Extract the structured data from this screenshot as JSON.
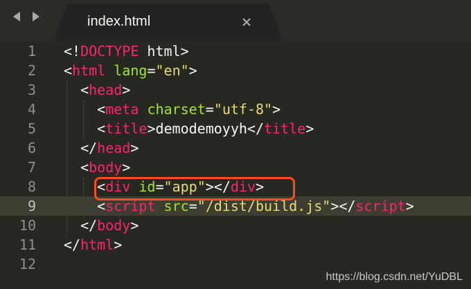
{
  "tab": {
    "title": "index.html",
    "close_icon": "close-icon"
  },
  "nav": {
    "back_icon": "chevron-left-icon",
    "forward_icon": "chevron-right-icon"
  },
  "lines": [
    {
      "num": "1",
      "tokens": [
        [
          "p",
          "<!"
        ],
        [
          "t",
          "DOCTYPE"
        ],
        [
          "p",
          " html>"
        ]
      ]
    },
    {
      "num": "2",
      "tokens": [
        [
          "p",
          "<"
        ],
        [
          "t",
          "html"
        ],
        [
          "p",
          " "
        ],
        [
          "a",
          "lang"
        ],
        [
          "p",
          "="
        ],
        [
          "s",
          "\"en\""
        ],
        [
          "p",
          ">"
        ]
      ]
    },
    {
      "num": "3",
      "tokens": [
        [
          "p",
          "  <"
        ],
        [
          "t",
          "head"
        ],
        [
          "p",
          ">"
        ]
      ]
    },
    {
      "num": "4",
      "tokens": [
        [
          "p",
          "    <"
        ],
        [
          "t",
          "meta"
        ],
        [
          "p",
          " "
        ],
        [
          "a",
          "charset"
        ],
        [
          "p",
          "="
        ],
        [
          "s",
          "\"utf-8\""
        ],
        [
          "p",
          ">"
        ]
      ]
    },
    {
      "num": "5",
      "tokens": [
        [
          "p",
          "    <"
        ],
        [
          "t",
          "title"
        ],
        [
          "p",
          ">demodemoyyh</"
        ],
        [
          "t",
          "title"
        ],
        [
          "p",
          ">"
        ]
      ]
    },
    {
      "num": "6",
      "tokens": [
        [
          "p",
          "  </"
        ],
        [
          "t",
          "head"
        ],
        [
          "p",
          ">"
        ]
      ]
    },
    {
      "num": "7",
      "tokens": [
        [
          "p",
          "  <"
        ],
        [
          "t",
          "body"
        ],
        [
          "p",
          ">"
        ]
      ]
    },
    {
      "num": "8",
      "tokens": [
        [
          "p",
          "    <"
        ],
        [
          "t",
          "div"
        ],
        [
          "p",
          " "
        ],
        [
          "a",
          "id"
        ],
        [
          "p",
          "="
        ],
        [
          "s",
          "\"app\""
        ],
        [
          "p",
          "></"
        ],
        [
          "t",
          "div"
        ],
        [
          "p",
          ">"
        ]
      ]
    },
    {
      "num": "9",
      "tokens": [
        [
          "p",
          "    <"
        ],
        [
          "t",
          "script"
        ],
        [
          "p",
          " "
        ],
        [
          "a",
          "src"
        ],
        [
          "p",
          "="
        ],
        [
          "s",
          "\"/dist/build.js\""
        ],
        [
          "p",
          "></"
        ],
        [
          "t",
          "script"
        ],
        [
          "p",
          ">"
        ]
      ]
    },
    {
      "num": "10",
      "tokens": [
        [
          "p",
          "  </"
        ],
        [
          "t",
          "body"
        ],
        [
          "p",
          ">"
        ]
      ]
    },
    {
      "num": "11",
      "tokens": [
        [
          "p",
          "</"
        ],
        [
          "t",
          "html"
        ],
        [
          "p",
          ">"
        ]
      ]
    },
    {
      "num": "12",
      "tokens": []
    }
  ],
  "active_line": "9",
  "highlighted_line": "8",
  "colors": {
    "background": "#272822",
    "tag": "#f92672",
    "attribute": "#a6e22e",
    "string": "#e6db74",
    "highlight_box": "#ff4a1f"
  },
  "watermark": "https://blog.csdn.net/YuDBL"
}
